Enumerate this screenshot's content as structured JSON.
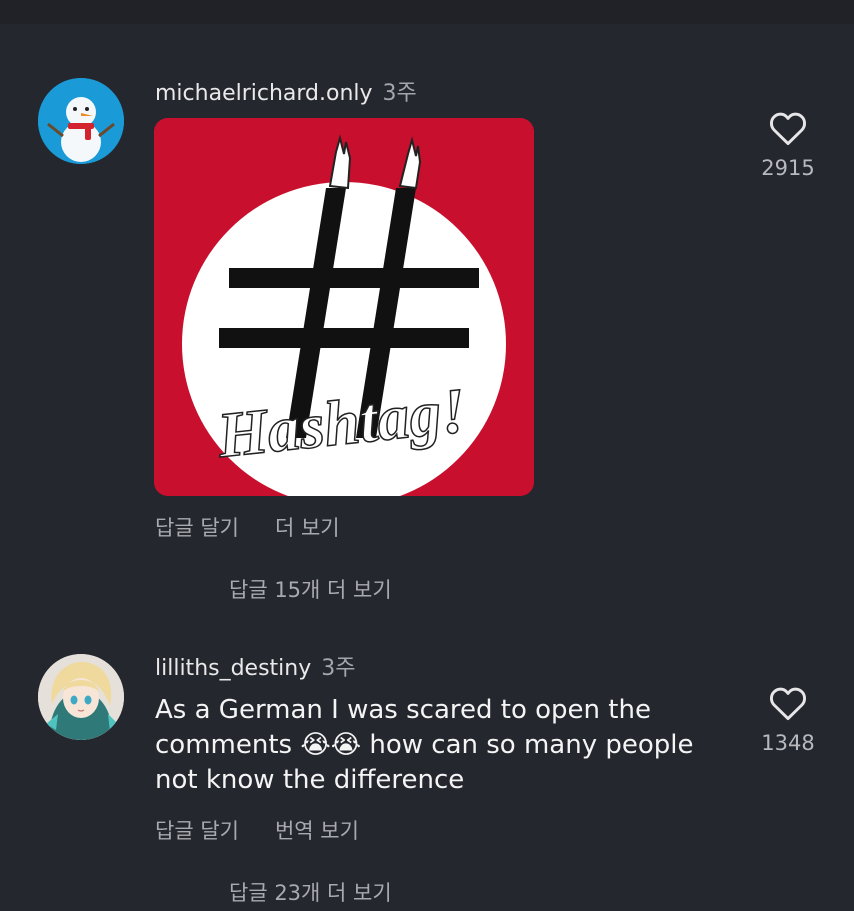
{
  "comments": [
    {
      "username": "michaelrichard.only",
      "age": "3주",
      "image": {
        "lettering": "Hashtag!",
        "colors": {
          "background": "#c8102e",
          "circle": "#ffffff",
          "symbol": "#111111"
        }
      },
      "likes": "2915",
      "actions": [
        "답글 달기",
        "더 보기"
      ],
      "view_replies": "답글 15개 더 보기",
      "avatar_icon": "snowman-avatar"
    },
    {
      "username": "lilliths_destiny",
      "age": "3주",
      "text": "As a German I was scared to open the comments 😭😭 how can so many people not know the difference",
      "likes": "1348",
      "actions": [
        "답글 달기",
        "번역 보기"
      ],
      "view_replies": "답글 23개 더 보기",
      "avatar_icon": "anime-girl-avatar"
    }
  ],
  "icons": {
    "like": "heart-outline-icon"
  },
  "colors": {
    "background": "#25272e",
    "text": "#f2f2f2",
    "muted": "#a8aaaf"
  }
}
